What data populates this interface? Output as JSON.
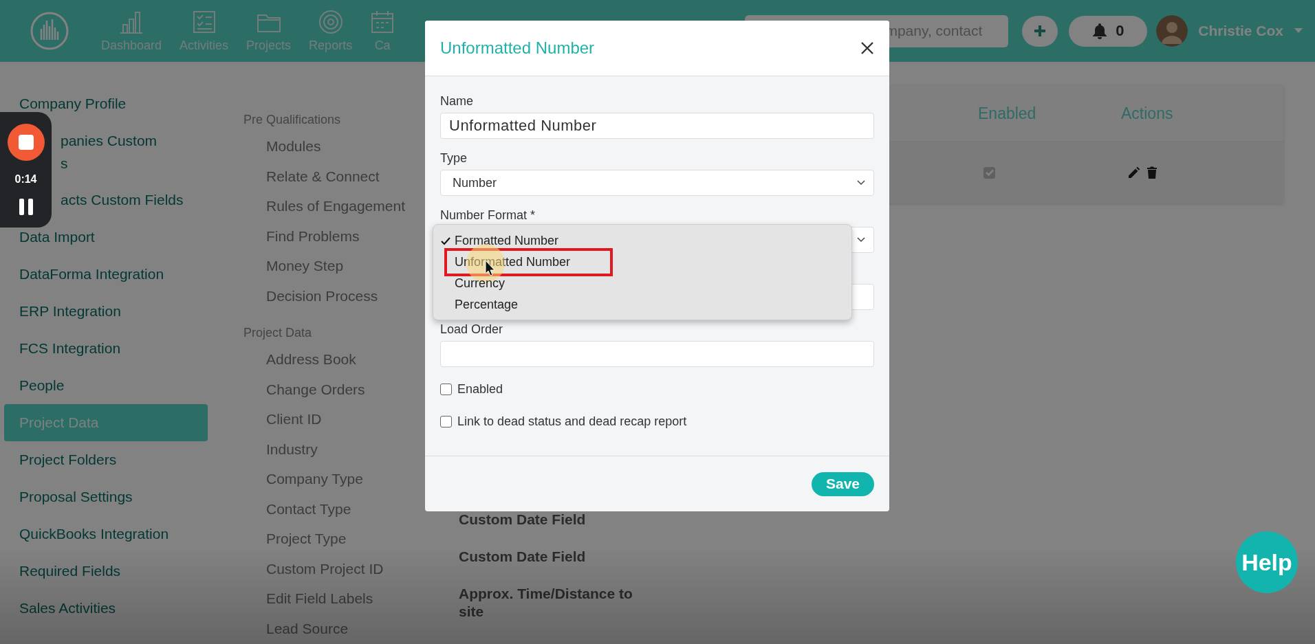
{
  "top_nav": {
    "items": [
      {
        "label": "Dashboard",
        "kind": "chart"
      },
      {
        "label": "Activities",
        "kind": "checklist"
      },
      {
        "label": "Projects",
        "kind": "folder"
      },
      {
        "label": "Reports",
        "kind": "target"
      },
      {
        "label": "Ca",
        "kind": "calendar"
      }
    ],
    "search": {
      "placeholder": "mpany, contact"
    },
    "notifications": {
      "count": "0"
    },
    "user": {
      "name": "Christie Cox"
    }
  },
  "settings_menu": {
    "items": [
      {
        "label": "Company Profile",
        "selected": false
      },
      {
        "label": "panies Custom\ns",
        "selected": false,
        "cut_left": true
      },
      {
        "label": "acts Custom Fields",
        "selected": false,
        "cut_left": true
      },
      {
        "label": "Data Import",
        "selected": false
      },
      {
        "label": "DataForma Integration",
        "selected": false
      },
      {
        "label": "ERP Integration",
        "selected": false
      },
      {
        "label": "FCS Integration",
        "selected": false
      },
      {
        "label": "People",
        "selected": false
      },
      {
        "label": "Project Data",
        "selected": true
      },
      {
        "label": "Project Folders",
        "selected": false
      },
      {
        "label": "Proposal Settings",
        "selected": false
      },
      {
        "label": "QuickBooks Integration",
        "selected": false
      },
      {
        "label": "Required Fields",
        "selected": false
      },
      {
        "label": "Sales Activities",
        "selected": false
      }
    ]
  },
  "submenu": {
    "sections": [
      {
        "title": "Pre Qualifications",
        "items": [
          "Modules",
          "Relate & Connect",
          "Rules of Engagement",
          "Find Problems",
          "Money Step",
          "Decision Process"
        ]
      },
      {
        "title": "Project Data",
        "items": [
          "Address Book",
          "Change Orders",
          "Client ID",
          "Industry",
          "Company Type",
          "Contact Type",
          "Project Type",
          "Custom Project ID",
          "Edit Field Labels",
          "Lead Source"
        ]
      }
    ]
  },
  "table": {
    "columns": [
      "Enabled",
      "Actions"
    ],
    "rows": [
      {
        "enabled": true
      }
    ]
  },
  "field_list": [
    "Custom Date Field",
    "Custom Date Field",
    "Approx. Time/Distance to site"
  ],
  "modal": {
    "title": "Unformatted Number",
    "fields": [
      {
        "kind": "text",
        "label": "Name",
        "value": "Unformatted Number"
      },
      {
        "kind": "select",
        "label": "Type",
        "value": "Number"
      },
      {
        "kind": "select",
        "label": "Number Format *"
      },
      {
        "kind": "blank"
      },
      {
        "kind": "text",
        "label": "Load Order"
      },
      {
        "kind": "checkbox",
        "label": "Enabled",
        "checked": false
      },
      {
        "kind": "checkbox",
        "label": "Link to dead status and dead recap report",
        "checked": false
      }
    ],
    "save_button": "Save"
  },
  "dropdown": {
    "options": [
      {
        "label": "Formatted Number",
        "checked": true,
        "highlighted": false
      },
      {
        "label": "Unformatted Number",
        "checked": false,
        "highlighted": true
      },
      {
        "label": "Currency",
        "checked": false,
        "highlighted": false
      },
      {
        "label": "Percentage",
        "checked": false,
        "highlighted": false
      }
    ]
  },
  "recorder": {
    "time": "0:14"
  },
  "help_button": "Help"
}
